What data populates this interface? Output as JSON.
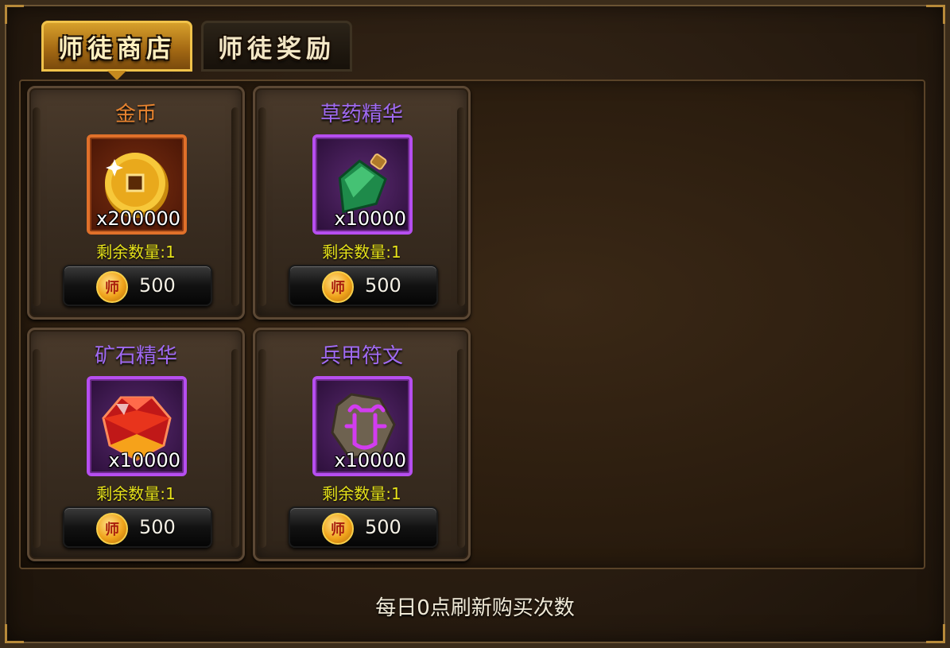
{
  "tabs": [
    {
      "label": "师徒商店",
      "active": true
    },
    {
      "label": "师徒奖励",
      "active": false
    }
  ],
  "items": [
    {
      "name": "金币",
      "name_color": "#e7832f",
      "icon": "gold-coin-icon",
      "quantity": "x200000",
      "remaining": "剩余数量:1",
      "price": "500"
    },
    {
      "name": "草药精华",
      "name_color": "#a06af2",
      "icon": "herb-essence-potion-icon",
      "quantity": "x10000",
      "remaining": "剩余数量:1",
      "price": "500"
    },
    {
      "name": "矿石精华",
      "name_color": "#a06af2",
      "icon": "ore-essence-gem-icon",
      "quantity": "x10000",
      "remaining": "剩余数量:1",
      "price": "500"
    },
    {
      "name": "兵甲符文",
      "name_color": "#a06af2",
      "icon": "armor-rune-icon",
      "quantity": "x10000",
      "remaining": "剩余数量:1",
      "price": "500"
    }
  ],
  "currency": {
    "icon": "master-coin-icon",
    "glyph": "师"
  },
  "footer": "每日0点刷新购买次数"
}
